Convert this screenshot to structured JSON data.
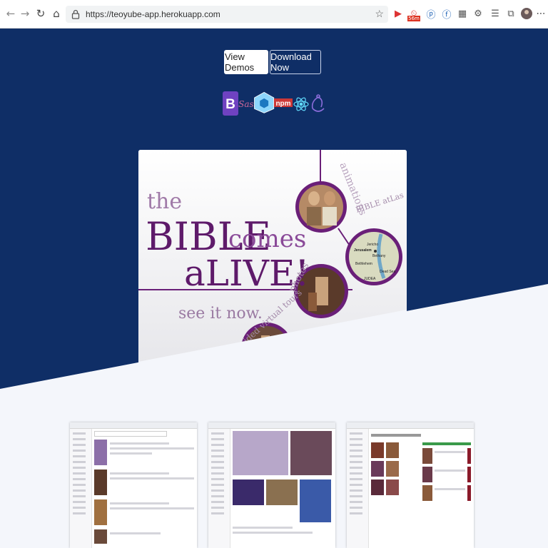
{
  "browser": {
    "url": "https://teoyube-app.herokuapp.com",
    "extension_badge": "56m"
  },
  "hero": {
    "buttons": {
      "view_demos": "View Demos",
      "download_now": "Download Now"
    },
    "tech_icons": [
      "bootstrap-icon",
      "sass-icon",
      "webpack-icon",
      "npm-icon",
      "react-icon",
      "redux-icon"
    ],
    "tech_labels": {
      "bootstrap": "B",
      "sass": "Sass",
      "npm": "npm"
    }
  },
  "preview": {
    "headline_the": "the",
    "headline_bible": "BIBLE",
    "headline_comes": "comes",
    "headline_alive": "aLIVE!",
    "tagline": "see it now.",
    "arc_labels": [
      "animations",
      "BIBLE atLas",
      "photos",
      "guided virtual tours"
    ],
    "map_labels": [
      "Jericho",
      "Jerusalem",
      "Bethany",
      "Bethlehem",
      "JUDEA",
      "Dead Sea"
    ]
  },
  "colors": {
    "hero_bg": "#0f2e66",
    "page_bg": "#f4f6fb",
    "bible_purple": "#5e1a6a"
  }
}
